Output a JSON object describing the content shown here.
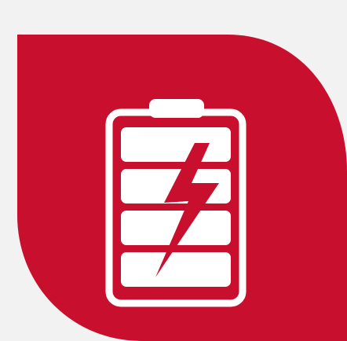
{
  "icon": {
    "name": "battery-charging-icon",
    "charge_level_segments": 4
  },
  "colors": {
    "background": "#f2f2f2",
    "badge_red": "#c8102e",
    "battery_white": "#ffffff",
    "bolt_red": "#c8102e"
  }
}
